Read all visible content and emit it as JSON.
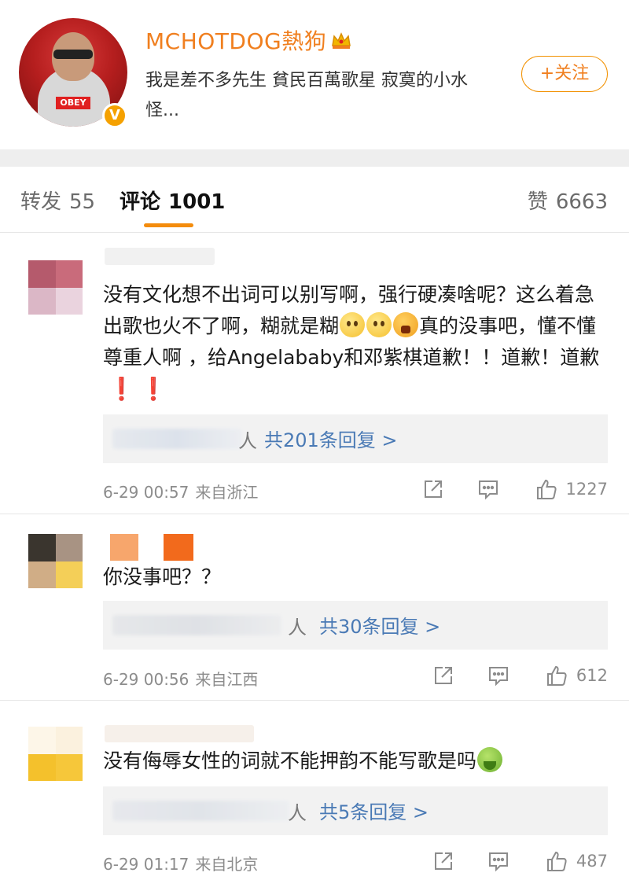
{
  "profile": {
    "name": "MCHOTDOG熱狗",
    "bio": "我是差不多先生 貧民百萬歌星 寂寞的小水怪...",
    "follow_label": "+关注",
    "avatar_logo": "OBEY",
    "verified_badge": "V"
  },
  "tabs": {
    "repost": {
      "label": "转发",
      "count": "55"
    },
    "comments": {
      "label": "评论",
      "count": "1001"
    },
    "likes": {
      "label": "赞",
      "count": "6663"
    }
  },
  "comments": [
    {
      "text_main": "没有文化想不出词可以别写啊，强行硬凑啥呢？这么着急出歌也火不了啊，糊就是糊",
      "text_after_emoji": "真的没事吧，懂不懂尊重人啊 ，给Angelababy和邓紫棋道歉！！道歉！道歉",
      "emojis": [
        "smirk-face",
        "smirk-face",
        "angry-face"
      ],
      "exclaims": [
        "❗",
        "❗"
      ],
      "reply_people": "人",
      "reply_link": "共201条回复 >",
      "time": "6-29 00:57",
      "location": "来自浙江",
      "likes": "1227"
    },
    {
      "text_main": "你没事吧？？",
      "reply_people": "人",
      "reply_link": "共30条回复 >",
      "time": "6-29 00:56",
      "location": "来自江西",
      "likes": "612"
    },
    {
      "text_main": "没有侮辱女性的词就不能押韵不能写歌是吗",
      "emojis": [
        "vomit-face"
      ],
      "reply_people": "人",
      "reply_link": "共5条回复 >",
      "time": "6-29 01:17",
      "location": "来自北京",
      "likes": "487"
    }
  ],
  "colors": {
    "accent_orange": "#f07f1f",
    "link_blue": "#4a7ab5",
    "meta_gray": "#8c8c8c",
    "divider": "#eeeeee"
  },
  "icons": [
    "crown-icon",
    "verified-icon",
    "share-icon",
    "reply-icon",
    "like-icon"
  ]
}
